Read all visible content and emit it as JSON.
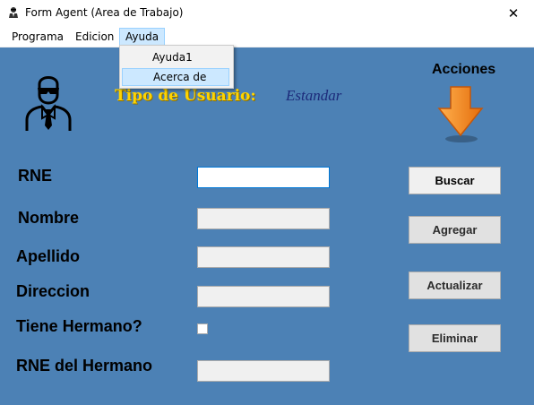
{
  "window": {
    "title": "Form Agent (Area de Trabajo)",
    "close_glyph": "✕"
  },
  "menu": {
    "items": [
      {
        "label": "Programa"
      },
      {
        "label": "Edicion"
      },
      {
        "label": "Ayuda"
      }
    ],
    "open_menu": {
      "items": [
        {
          "label": "Ayuda1"
        },
        {
          "label": "Acerca de"
        }
      ]
    }
  },
  "header": {
    "tipo_usuario_label": "Tipo de Usuario:",
    "tipo_usuario_value": "Estandar",
    "acciones_label": "Acciones"
  },
  "form": {
    "fields": [
      {
        "label": "RNE",
        "value": ""
      },
      {
        "label": "Nombre",
        "value": ""
      },
      {
        "label": "Apellido",
        "value": ""
      },
      {
        "label": "Direccion",
        "value": ""
      },
      {
        "label": "Tiene Hermano?",
        "checked": false
      },
      {
        "label": "RNE del Hermano",
        "value": ""
      }
    ]
  },
  "actions": {
    "buscar": "Buscar",
    "agregar": "Agregar",
    "actualizar": "Actualizar",
    "eliminar": "Eliminar"
  },
  "colors": {
    "workarea_bg": "#4c81b5",
    "tipo_label": "#ffd400",
    "tipo_value": "#1c2a7a",
    "arrow": "#f28a1e"
  },
  "icons": {
    "app": "agent-app-icon",
    "agent": "secret-agent-icon",
    "arrow": "down-arrow-icon"
  }
}
